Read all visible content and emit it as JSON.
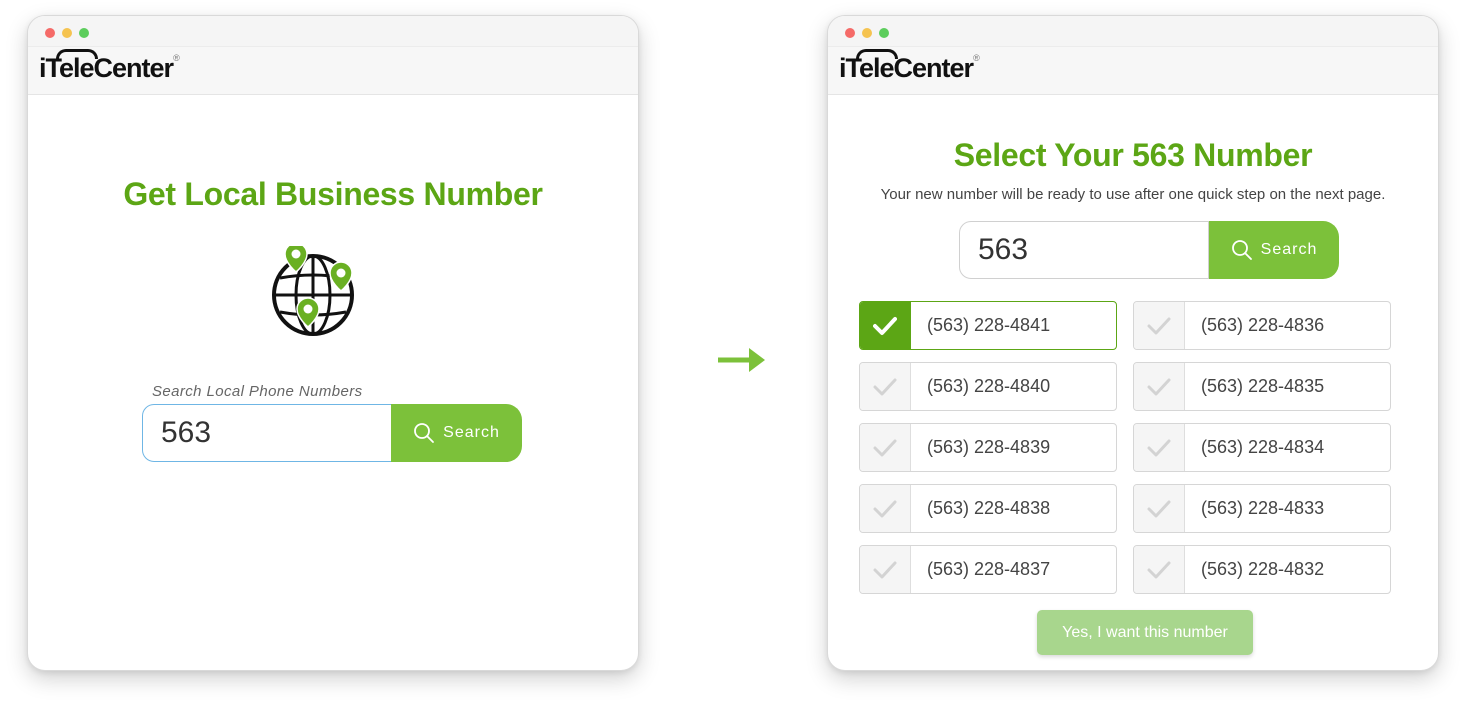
{
  "brand": {
    "name_prefix": "i",
    "name_tele": "Tele",
    "name_suffix": "Center",
    "registered_mark": "®",
    "accent_color": "#5ca615",
    "button_color": "#7cc13a"
  },
  "left_window": {
    "title": "Get Local Business Number",
    "globe_icon": "globe-with-location-pins-icon",
    "search": {
      "label": "Search Local Phone Numbers",
      "value": "563",
      "button_label": "Search"
    }
  },
  "transition_icon": "right-arrow-icon",
  "right_window": {
    "title": "Select Your 563 Number",
    "subtitle": "Your new number will be ready to use after one quick step on the next page.",
    "search": {
      "value": "563",
      "button_label": "Search"
    },
    "numbers": [
      {
        "number": "(563) 228-4841",
        "selected": true
      },
      {
        "number": "(563) 228-4836",
        "selected": false
      },
      {
        "number": "(563) 228-4840",
        "selected": false
      },
      {
        "number": "(563) 228-4835",
        "selected": false
      },
      {
        "number": "(563) 228-4839",
        "selected": false
      },
      {
        "number": "(563) 228-4834",
        "selected": false
      },
      {
        "number": "(563) 228-4838",
        "selected": false
      },
      {
        "number": "(563) 228-4833",
        "selected": false
      },
      {
        "number": "(563) 228-4837",
        "selected": false
      },
      {
        "number": "(563) 228-4832",
        "selected": false
      }
    ],
    "confirm_button_label": "Yes, I want this number"
  }
}
